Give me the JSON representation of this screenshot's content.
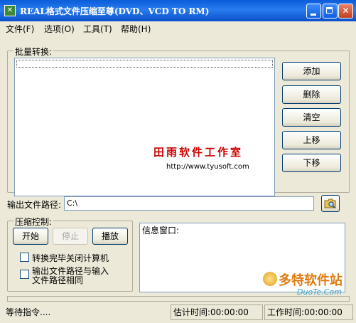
{
  "window": {
    "title": "REAL格式文件压缩至尊(DVD、VCD TO RM)",
    "app_icon": "app-icon"
  },
  "menu": [
    "文件(F)",
    "选项(O)",
    "工具(T)",
    "帮助(H)"
  ],
  "batch": {
    "label": "批量转换:",
    "buttons": [
      "添加",
      "删除",
      "清空",
      "上移",
      "下移"
    ]
  },
  "watermark": {
    "title": "田雨软件工作室",
    "url": "http://www.tyusoft.com"
  },
  "output": {
    "label": "输出文件路径:",
    "value": "C:\\",
    "browse_icon": "folder-search-icon"
  },
  "compress": {
    "label": "压缩控制:",
    "start": "开始",
    "stop": "停止",
    "play": "播放",
    "check1": "转换完毕关闭计算机",
    "check2_line1": "输出文件路径与输入",
    "check2_line2": "文件路径相同"
  },
  "info": {
    "label": "信息窗口:"
  },
  "status": {
    "state": "等待指令....",
    "estimated": "估计时间:00:00:00",
    "worktime": "工作时间:00:00:00"
  },
  "watermark2": {
    "main": "多特软件站",
    "sub": "DuoTe.Com"
  }
}
